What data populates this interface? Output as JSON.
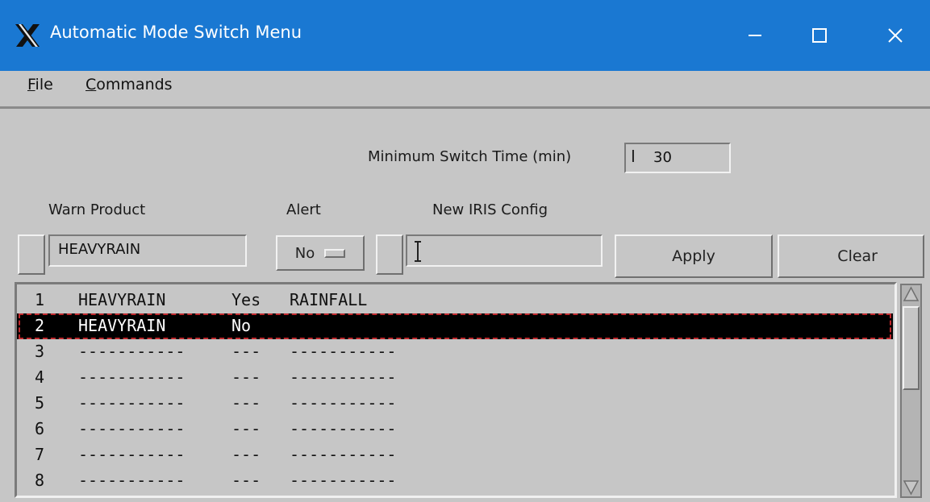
{
  "window": {
    "title": "Automatic Mode Switch Menu",
    "accent": "#1a78d2"
  },
  "menubar": {
    "file": {
      "mnemonic": "F",
      "rest": "ile"
    },
    "commands": {
      "mnemonic": "C",
      "rest": "ommands"
    }
  },
  "min_switch": {
    "label": "Minimum Switch Time (min)",
    "value": "30"
  },
  "form": {
    "warn_product_label": "Warn Product",
    "alert_label": "Alert",
    "iris_label": "New IRIS Config",
    "warn_product_value": "HEAVYRAIN",
    "alert_value": "No",
    "iris_value": "",
    "apply_label": "Apply",
    "clear_label": "Clear"
  },
  "list": {
    "selected_index": 1,
    "rows": [
      {
        "num": "1",
        "product": "HEAVYRAIN",
        "alert": "Yes",
        "config": "RAINFALL"
      },
      {
        "num": "2",
        "product": "HEAVYRAIN",
        "alert": "No",
        "config": ""
      },
      {
        "num": "3",
        "product": "-----------",
        "alert": "---",
        "config": "-----------"
      },
      {
        "num": "4",
        "product": "-----------",
        "alert": "---",
        "config": "-----------"
      },
      {
        "num": "5",
        "product": "-----------",
        "alert": "---",
        "config": "-----------"
      },
      {
        "num": "6",
        "product": "-----------",
        "alert": "---",
        "config": "-----------"
      },
      {
        "num": "7",
        "product": "-----------",
        "alert": "---",
        "config": "-----------"
      },
      {
        "num": "8",
        "product": "-----------",
        "alert": "---",
        "config": "-----------"
      }
    ]
  },
  "icons": [
    "x-logo-icon",
    "minimize-icon",
    "maximize-icon",
    "close-icon",
    "scroll-up-arrow-icon",
    "scroll-down-arrow-icon"
  ]
}
